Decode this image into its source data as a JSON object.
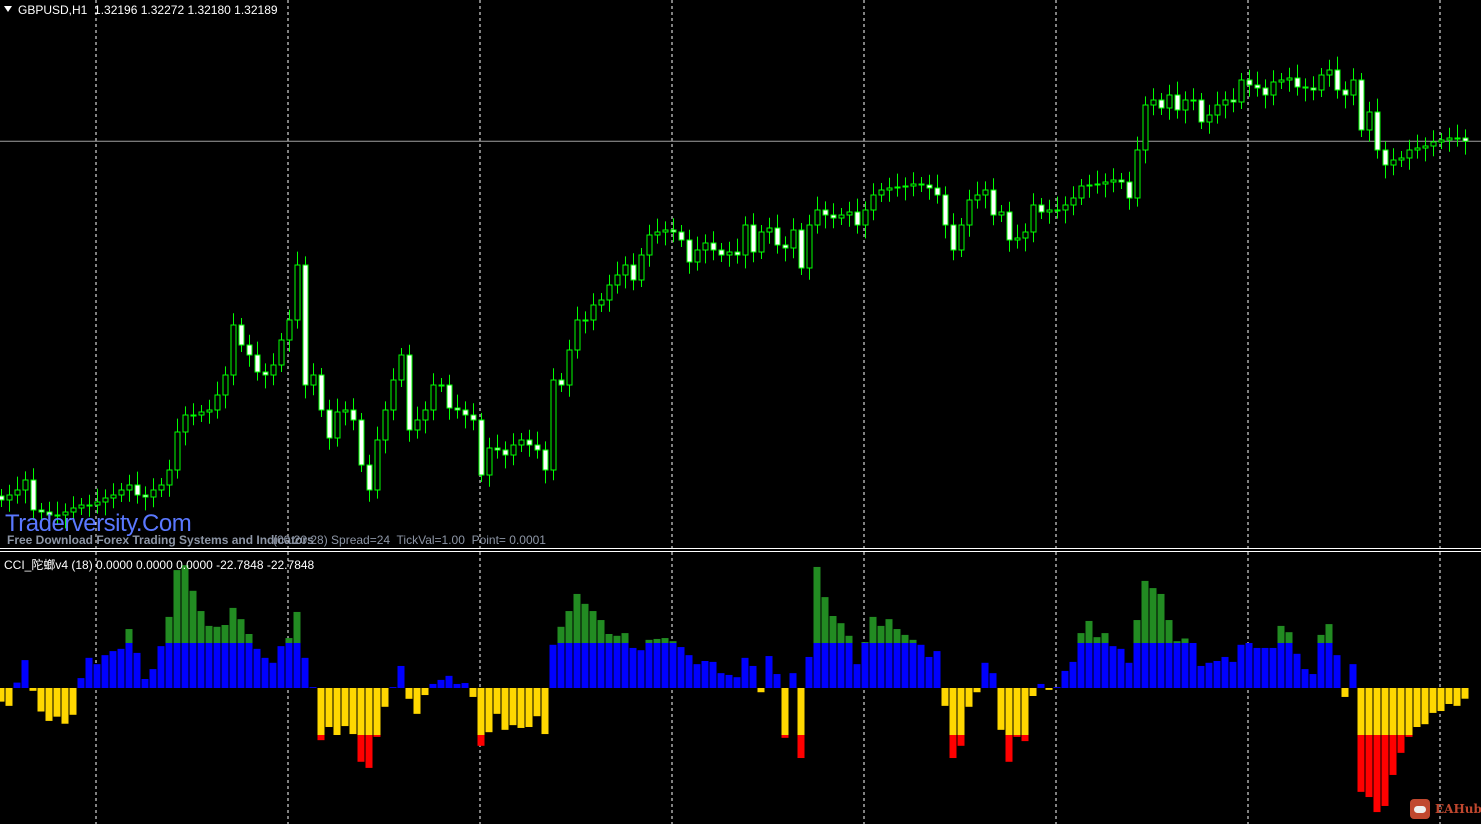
{
  "header": {
    "symbol": "GBPUSD,H1",
    "ohlc": "1.32196 1.32272 1.32180 1.32189"
  },
  "watermark": {
    "brand": "Traderversity.Com",
    "tagline": "Free Download Forex Trading Systems and Indicators"
  },
  "info_line": "(00:20:28) Spread=24  TickVal=1.00  Point= 0.0001",
  "indicator": {
    "label": "CCI_陀螂v4 (18) 0.0000 0.0000 0.0000 -22.7848 -22.7848"
  },
  "logo": {
    "text": "EAHub"
  },
  "colors": {
    "background": "#000000",
    "candle": "#00ff00",
    "bear_body": "#ffffff",
    "grid": "#ffffff",
    "bid_line": "#a0a0a0",
    "cci_blue": "#0000ff",
    "cci_green": "#228b22",
    "cci_yellow": "#ffd700",
    "cci_red": "#ff0000"
  },
  "chart_data": [
    {
      "type": "candlestick",
      "title": "GBPUSD,H1",
      "bid": 1.32189,
      "grid": true,
      "closes": [
        1.30395,
        1.3042,
        1.30445,
        1.30495,
        1.30345,
        1.30335,
        1.3032,
        1.3032,
        1.30335,
        1.30355,
        1.3037,
        1.3037,
        1.30385,
        1.30405,
        1.3042,
        1.30445,
        1.3047,
        1.3042,
        1.3041,
        1.30445,
        1.3047,
        1.30545,
        1.30735,
        1.3082,
        1.3082,
        1.30835,
        1.30845,
        1.3092,
        1.3102,
        1.3127,
        1.3117,
        1.3112,
        1.31035,
        1.3102,
        1.3107,
        1.31195,
        1.31295,
        1.3157,
        1.3097,
        1.3102,
        1.30845,
        1.30705,
        1.30835,
        1.30845,
        1.30795,
        1.3057,
        1.30445,
        1.30695,
        1.30845,
        1.30995,
        1.3112,
        1.30745,
        1.30795,
        1.30845,
        1.3097,
        1.3097,
        1.30855,
        1.30845,
        1.3082,
        1.30795,
        1.3052,
        1.30655,
        1.30645,
        1.3062,
        1.3067,
        1.30695,
        1.3067,
        1.30645,
        1.30545,
        1.30995,
        1.3097,
        1.31145,
        1.31295,
        1.31295,
        1.3137,
        1.31395,
        1.3147,
        1.3152,
        1.3157,
        1.31495,
        1.3162,
        1.3172,
        1.31735,
        1.31745,
        1.31735,
        1.31695,
        1.31585,
        1.31645,
        1.3168,
        1.31645,
        1.3162,
        1.31635,
        1.3162,
        1.3177,
        1.31635,
        1.31735,
        1.31755,
        1.3167,
        1.31655,
        1.31745,
        1.31555,
        1.3177,
        1.31845,
        1.3182,
        1.31805,
        1.3182,
        1.31835,
        1.3177,
        1.31845,
        1.3192,
        1.31945,
        1.31955,
        1.3196,
        1.31965,
        1.31975,
        1.3197,
        1.31955,
        1.3192,
        1.3177,
        1.31645,
        1.3177,
        1.31895,
        1.3192,
        1.31945,
        1.3182,
        1.31835,
        1.31695,
        1.31705,
        1.31735,
        1.3187,
        1.31835,
        1.31845,
        1.31845,
        1.3187,
        1.31905,
        1.31965,
        1.3197,
        1.31975,
        1.31985,
        1.31995,
        1.31985,
        1.31905,
        1.32145,
        1.3237,
        1.32395,
        1.32355,
        1.3242,
        1.32345,
        1.32395,
        1.32395,
        1.32285,
        1.3232,
        1.3237,
        1.32395,
        1.32385,
        1.32495,
        1.3247,
        1.32455,
        1.3242,
        1.32485,
        1.32495,
        1.32505,
        1.3246,
        1.32455,
        1.32445,
        1.3252,
        1.32545,
        1.32445,
        1.3242,
        1.32495,
        1.32245,
        1.32335,
        1.32145,
        1.3207,
        1.32095,
        1.32105,
        1.32145,
        1.32155,
        1.32165,
        1.32185,
        1.32195,
        1.32205,
        1.32205,
        1.32189
      ]
    },
    {
      "type": "bar",
      "title": "CCI_陀螂v4 (18)",
      "levels": [
        100,
        -100
      ],
      "values": [
        -29,
        -38,
        12,
        62,
        -6,
        -50,
        -70,
        -61,
        -76,
        -57,
        22,
        67,
        53,
        73,
        82,
        87,
        131,
        78,
        20,
        42,
        93,
        158,
        262,
        273,
        216,
        171,
        138,
        136,
        140,
        178,
        153,
        120,
        87,
        67,
        56,
        93,
        111,
        169,
        67,
        2,
        -111,
        -83,
        -100,
        -81,
        -98,
        -157,
        -170,
        -104,
        -40,
        2,
        49,
        -23,
        -55,
        -15,
        9,
        18,
        27,
        9,
        11,
        -19,
        -123,
        -94,
        -55,
        -89,
        -79,
        -85,
        -83,
        -60,
        -98,
        96,
        136,
        171,
        209,
        187,
        171,
        151,
        120,
        116,
        122,
        89,
        84,
        107,
        109,
        111,
        104,
        91,
        73,
        53,
        60,
        58,
        33,
        29,
        24,
        67,
        49,
        -9,
        71,
        31,
        -106,
        33,
        -149,
        69,
        269,
        202,
        160,
        144,
        116,
        53,
        102,
        158,
        138,
        153,
        131,
        118,
        107,
        96,
        69,
        82,
        -38,
        -149,
        -123,
        -40,
        -9,
        56,
        33,
        -89,
        -157,
        -104,
        -113,
        -17,
        9,
        -4,
        2,
        38,
        58,
        122,
        149,
        113,
        122,
        93,
        87,
        56,
        151,
        238,
        222,
        209,
        151,
        104,
        110,
        100,
        49,
        56,
        60,
        69,
        58,
        96,
        100,
        89,
        89,
        89,
        138,
        124,
        76,
        42,
        31,
        118,
        142,
        73,
        -19,
        53,
        -221,
        -232,
        -264,
        -251,
        -185,
        -138,
        -104,
        -83,
        -77,
        -53,
        -49,
        -34,
        -38,
        -22.78
      ]
    }
  ]
}
